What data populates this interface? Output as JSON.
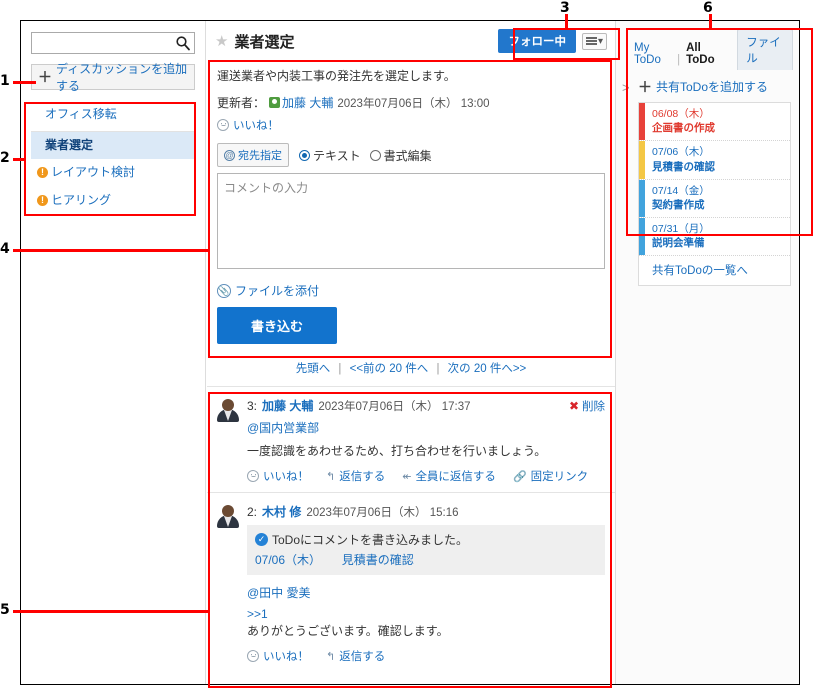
{
  "sidebar": {
    "search": {
      "value": "",
      "placeholder": ""
    },
    "search_icon": "search-icon",
    "add_discussion_label": "ディスカッションを追加する",
    "items": [
      {
        "label": "オフィス移転",
        "state": "parent",
        "icon": ""
      },
      {
        "label": "業者選定",
        "state": "current",
        "icon": ""
      },
      {
        "label": "レイアウト検討",
        "state": "normal",
        "icon": "alert-icon"
      },
      {
        "label": "ヒアリング",
        "state": "normal",
        "icon": "alert-icon"
      }
    ]
  },
  "topic": {
    "star_icon": "star-icon",
    "title": "業者選定",
    "follow_label": "フォロー中",
    "menu_icon": "list-menu-icon",
    "menu_caret": "▾",
    "description": "運送業者や内装工事の発注先を選定します。",
    "updater_label": "更新者：",
    "updater_name": "加藤 大輔",
    "updated_at": "2023年07月06日（木） 13:00",
    "like_label": "いいね！"
  },
  "compose": {
    "address_label": "宛先指定",
    "at_icon": "at-icon",
    "radio_text": "テキスト",
    "radio_rich": "書式編集",
    "selected": "テキスト",
    "comment_value": "",
    "comment_placeholder": "コメントの入力",
    "attach_label": "ファイルを添付",
    "attach_icon": "paperclip-icon",
    "submit_label": "書き込む"
  },
  "pager": {
    "first": "先頭へ",
    "prev": "<<前の 20 件へ",
    "next": "次の 20 件へ>>",
    "separator": "|"
  },
  "comments": [
    {
      "number": "3:",
      "author": "加藤 大輔",
      "time": "2023年07月06日（木） 17:37",
      "delete_label": "削除",
      "delete_icon": "x-icon",
      "mention": "@国内営業部",
      "text": "一度認識をあわせるため、打ち合わせを行いましょう。",
      "actions": [
        {
          "label": "いいね！",
          "icon": "smiley-icon"
        },
        {
          "label": "返信する",
          "icon": "reply-icon"
        },
        {
          "label": "全員に返信する",
          "icon": "reply-all-icon"
        },
        {
          "label": "固定リンク",
          "icon": "link-icon"
        }
      ]
    },
    {
      "number": "2:",
      "author": "木村 修",
      "time": "2023年07月06日（木） 15:16",
      "todo_box": {
        "icon": "check-circle-icon",
        "line1": "ToDoにコメントを書き込みました。",
        "date": "07/06（木）",
        "name": "見積書の確認"
      },
      "mention": "@田中 愛美",
      "quote": ">>1",
      "text": "ありがとうございます。確認します。",
      "actions": [
        {
          "label": "いいね！",
          "icon": "smiley-icon"
        },
        {
          "label": "返信する",
          "icon": "reply-icon"
        }
      ]
    }
  ],
  "right_panel": {
    "collapse_icon": "chevron-right-icon",
    "tabs": [
      {
        "label": "My ToDo",
        "active": false
      },
      {
        "label": "All ToDo",
        "active": true
      },
      {
        "label": "ファイル",
        "active": false
      }
    ],
    "tab_divider": "|",
    "add_shared_todo_label": "共有ToDoを追加する",
    "todos": [
      {
        "date": "06/08（木）",
        "name": "企画書の作成",
        "bar_color": "#e8413a",
        "state": "overdue"
      },
      {
        "date": "07/06（木）",
        "name": "見積書の確認",
        "bar_color": "#f4c744",
        "state": "normal"
      },
      {
        "date": "07/14（金）",
        "name": "契約書作成",
        "bar_color": "#41a3dd",
        "state": "normal"
      },
      {
        "date": "07/31（月）",
        "name": "説明会準備",
        "bar_color": "#41a3dd",
        "state": "normal"
      }
    ],
    "footer_label": "共有ToDoの一覧へ"
  },
  "annotations": [
    {
      "id": "1",
      "number": "1"
    },
    {
      "id": "2",
      "number": "2"
    },
    {
      "id": "3",
      "number": "3"
    },
    {
      "id": "4",
      "number": "4"
    },
    {
      "id": "5",
      "number": "5"
    },
    {
      "id": "6",
      "number": "6"
    }
  ],
  "colors": {
    "accent_blue": "#1a6ebd",
    "follow_blue": "#2277cc",
    "submit_blue": "#1273cd",
    "annotation_red": "#ff0000",
    "overdue_red": "#e03a2f",
    "alert_orange": "#f0971b"
  }
}
